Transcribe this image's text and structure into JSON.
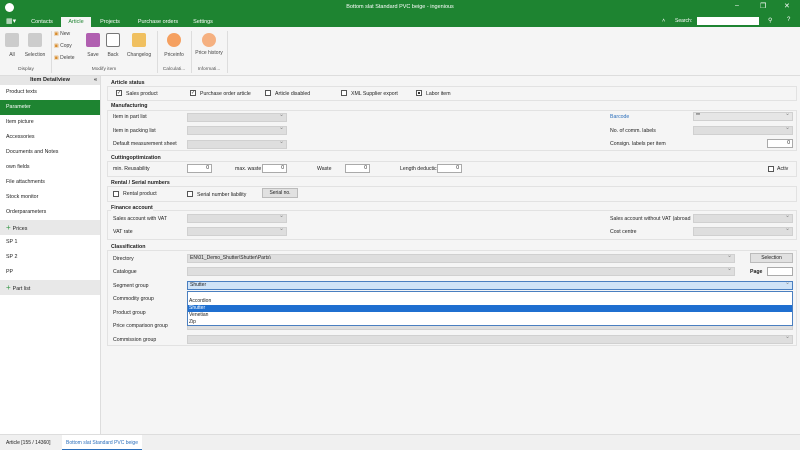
{
  "window": {
    "title": "Bottom slat Standard PVC beige - ingenious",
    "search_label": "Search:",
    "search_value": ""
  },
  "tabs": [
    "Contacts",
    "Article",
    "Projects",
    "Purchase orders",
    "Settings"
  ],
  "active_tab": "Article",
  "ribbon": {
    "display": {
      "label": "Display",
      "all": "All",
      "selection": "Selection"
    },
    "modify": {
      "label": "Modify item",
      "new": "New",
      "copy": "Copy",
      "delete": "Delete",
      "save": "Save",
      "back": "Back",
      "changelog": "Changelog"
    },
    "calc": {
      "label": "Calculati...",
      "priceinfo": "Priceinfo"
    },
    "info": {
      "label": "Informati...",
      "price_history": "Price history"
    }
  },
  "sidebar": {
    "title": "Item Detailview",
    "items": [
      "Product texts",
      "Parameter",
      "Item picture",
      "Accessories",
      "Documents and Notes",
      "own fields",
      "File attachments",
      "Stock monitor",
      "Orderparameters",
      "Prices",
      "SP 1",
      "SP 2",
      "PP",
      "Part list"
    ],
    "selected": "Parameter"
  },
  "article_status": {
    "title": "Article status",
    "sales_product": "Sales product",
    "purchase_order_article": "Purchase order article",
    "article_disabled": "Article disabled",
    "xml_supplier_export": "XML Supplier export",
    "labor_item": "Labor item",
    "checked": {
      "sales_product": true,
      "purchase_order_article": true,
      "article_disabled": false,
      "xml_supplier_export": false,
      "labor_item": "indeterminate"
    }
  },
  "manufacturing": {
    "title": "Manufacturing",
    "item_in_part_list": "Item in part list",
    "item_in_packing_list": "Item in packing list",
    "default_measurement_sheet": "Default measurement sheet",
    "barcode": "Barcode",
    "barcode_value": "**",
    "no_comm_labels": "No. of comm. labels",
    "consign_labels": "Consign. labels per item",
    "consign_labels_value": "0"
  },
  "cutting": {
    "title": "Cuttingoptimization",
    "min_reusability": "min. Reusability",
    "min_reusability_value": "0",
    "max_waste": "max. waste",
    "max_waste_value": "0",
    "waste": "Waste",
    "waste_value": "0",
    "length_deduction": "Length deductic",
    "length_deduction_value": "0",
    "activ": "Activ"
  },
  "rental": {
    "title": "Rental / Serial numbers",
    "rental_product": "Rental product",
    "serial_number_liability": "Serial number liability",
    "serial_no_button": "Serial no."
  },
  "finance": {
    "title": "Finance account",
    "sales_with_vat": "Sales account with VAT",
    "vat_rate": "VAT rate",
    "sales_without_vat": "Sales account without VAT (abroad",
    "cost_centre": "Cost centre"
  },
  "classification": {
    "title": "Classification",
    "directory": "Directory",
    "directory_value": "EN\\01_Demo_Shutter\\Shutter\\Parts\\",
    "selection_button": "Selection",
    "catalogue": "Catalogue",
    "page": "Page",
    "segment_group": "Segment group",
    "segment_value": "Shutter",
    "commodity_group": "Commodity group",
    "product_group": "Product group",
    "price_comparison_group": "Price comparison group",
    "commission_group": "Commission group",
    "dropdown_options": [
      "Accordion",
      "Shutter",
      "Venetian",
      "Zip"
    ],
    "dropdown_selected": "Shutter"
  },
  "statusbar": {
    "tab1": "Article [155 / 14360]",
    "tab2": "Bottom slat Standard PVC beige"
  },
  "colors": {
    "brand": "#1e8431",
    "link": "#2a6ebb",
    "selection": "#1f6fd0"
  }
}
